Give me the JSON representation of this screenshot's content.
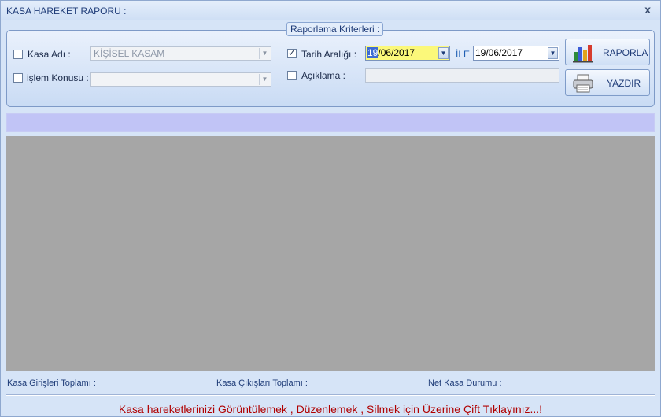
{
  "window": {
    "title": "KASA HAREKET RAPORU :",
    "close_glyph": "x"
  },
  "criteria": {
    "legend": "Raporlama Kriterleri :",
    "kasa_adi": {
      "label": "Kasa Adı :",
      "checked": false,
      "value": "KİŞİSEL KASAM"
    },
    "islem_konusu": {
      "label": "işlem Konusu :",
      "checked": false,
      "value": ""
    },
    "tarih_araligi": {
      "label": "Tarih  Aralığı :",
      "checked": true
    },
    "date_from": {
      "selected": "19",
      "rest": "/06/2017"
    },
    "ile": "İLE",
    "date_to": "19/06/2017",
    "aciklama": {
      "label": "Açıklama :",
      "checked": false,
      "value": ""
    }
  },
  "buttons": {
    "raporla": {
      "label": "RAPORLA",
      "icon": "bar-chart-icon"
    },
    "yazdir": {
      "label": "YAZDIR",
      "icon": "printer-icon"
    }
  },
  "totals": {
    "girisler": "Kasa Girişleri Toplamı :",
    "cikislar": "Kasa Çıkışları Toplamı :",
    "net": "Net Kasa Durumu :"
  },
  "hint": "Kasa hareketlerinizi Görüntülemek , Düzenlemek , Silmek için Üzerine Çift Tıklayınız...!",
  "colors": {
    "hint": "#b00000",
    "strip": "#c1c4f6",
    "grid": "#a6a6a6",
    "active_date": "#fbf87a"
  }
}
